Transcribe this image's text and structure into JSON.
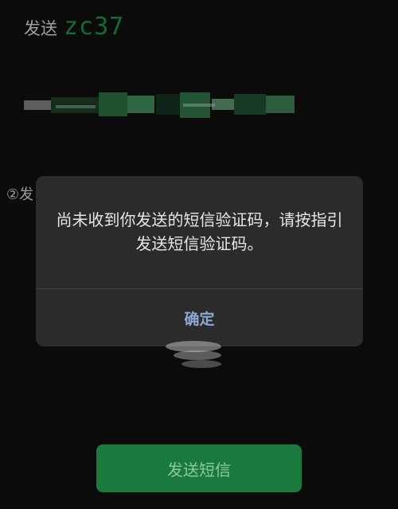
{
  "header": {
    "send_label": "发送",
    "code": "zc37"
  },
  "steps": {
    "step2_partial": "②发"
  },
  "dialog": {
    "message": "尚未收到你发送的短信验证码，请按指引发送短信验证码。",
    "confirm_label": "确定"
  },
  "footer": {
    "send_sms_label": "发送短信"
  },
  "colors": {
    "code_green": "#1b8e4a",
    "button_green": "#1a7a3d",
    "confirm_blue": "#8ea8cf",
    "dialog_bg": "#2b2b2b"
  }
}
